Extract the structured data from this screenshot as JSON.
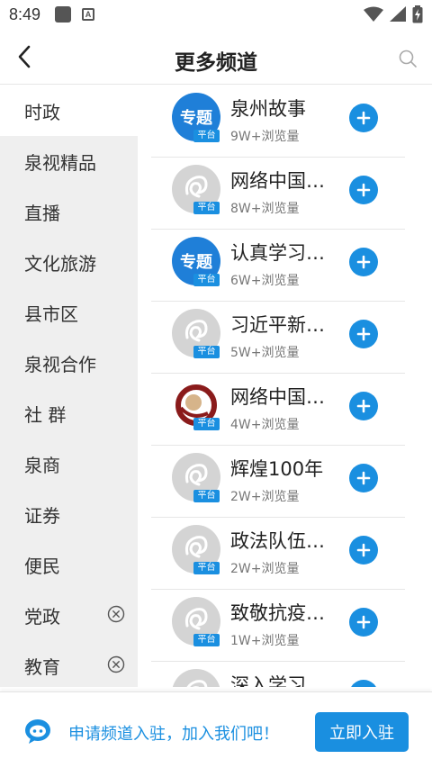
{
  "status_bar": {
    "time": "8:49",
    "a_badge": "A",
    "icons": [
      "notification-square-icon",
      "a-badge-icon",
      "wifi-icon",
      "signal-icon",
      "battery-charging-icon"
    ]
  },
  "header": {
    "title": "更多频道",
    "back_icon": "chevron-left-icon",
    "search_icon": "search-icon"
  },
  "sidebar": {
    "items": [
      {
        "label": "时政",
        "active": true,
        "removable": false
      },
      {
        "label": "泉视精品",
        "active": false,
        "removable": false
      },
      {
        "label": "直播",
        "active": false,
        "removable": false
      },
      {
        "label": "文化旅游",
        "active": false,
        "removable": false
      },
      {
        "label": "县市区",
        "active": false,
        "removable": false
      },
      {
        "label": "泉视合作",
        "active": false,
        "removable": false
      },
      {
        "label": "社 群",
        "active": false,
        "removable": false
      },
      {
        "label": "泉商",
        "active": false,
        "removable": false
      },
      {
        "label": "证券",
        "active": false,
        "removable": false
      },
      {
        "label": "便民",
        "active": false,
        "removable": false
      },
      {
        "label": "党政",
        "active": false,
        "removable": true
      },
      {
        "label": "教育",
        "active": false,
        "removable": true
      }
    ]
  },
  "channels": {
    "platform_tag": "平台",
    "topic_label": "专题",
    "items": [
      {
        "name": "泉州故事",
        "views": "9W+浏览量",
        "avatar": "topic"
      },
      {
        "name": "网络中国…",
        "views": "8W+浏览量",
        "avatar": "placeholder"
      },
      {
        "name": "认真学习…",
        "views": "6W+浏览量",
        "avatar": "topic"
      },
      {
        "name": "习近平新…",
        "views": "5W+浏览量",
        "avatar": "placeholder"
      },
      {
        "name": "网络中国…",
        "views": "4W+浏览量",
        "avatar": "red-logo"
      },
      {
        "name": "辉煌100年",
        "views": "2W+浏览量",
        "avatar": "placeholder"
      },
      {
        "name": "政法队伍…",
        "views": "2W+浏览量",
        "avatar": "placeholder"
      },
      {
        "name": "致敬抗疫…",
        "views": "1W+浏览量",
        "avatar": "placeholder"
      },
      {
        "name": "深入学习…",
        "views": "",
        "avatar": "placeholder"
      }
    ]
  },
  "bottom_bar": {
    "text": "申请频道入驻，加入我们吧！",
    "button": "立即入驻",
    "icon": "chat-robot-icon"
  },
  "colors": {
    "accent": "#1a8fe0",
    "sidebar_bg": "#efefef",
    "topic_blue": "#1f7fd8"
  }
}
